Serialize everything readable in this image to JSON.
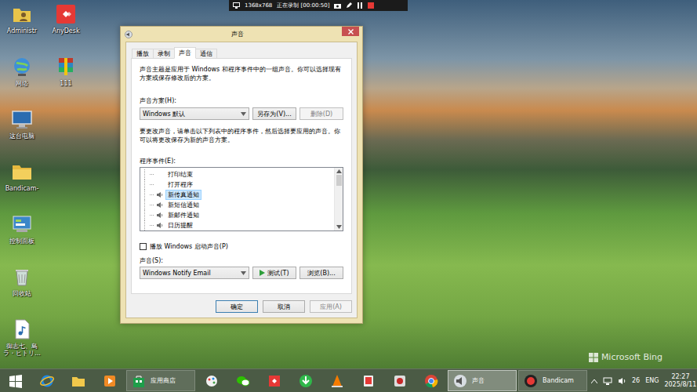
{
  "recorder_bar": {
    "resolution": "1368x768",
    "status": "正在录制 [00:00:50]"
  },
  "desktop": {
    "icons": [
      {
        "label": "Administr",
        "kind": "user"
      },
      {
        "label": "网络",
        "kind": "network"
      },
      {
        "label": "这台电脑",
        "kind": "computer"
      },
      {
        "label": "Bandicam-",
        "kind": "folder"
      },
      {
        "label": "控制面板",
        "kind": "control-panel"
      },
      {
        "label": "回收站",
        "kind": "recycle-bin"
      },
      {
        "label": "御志七、島ラ・ヒトリ...",
        "kind": "audio-file"
      },
      {
        "label": "AnyDesk",
        "kind": "anydesk"
      },
      {
        "label": "111",
        "kind": "archive"
      }
    ],
    "watermark": "Microsoft Bing"
  },
  "window": {
    "title": "声音"
  },
  "tabs": [
    {
      "label": "播放",
      "selected": false
    },
    {
      "label": "录制",
      "selected": false
    },
    {
      "label": "声音",
      "selected": true
    },
    {
      "label": "通信",
      "selected": false
    }
  ],
  "scheme": {
    "description": "声音主题是应用于 Windows 和程序事件中的一组声音。你可以选择现有方案或保存修改后的方案。",
    "label": "声音方案(H):",
    "value": "Windows 默认",
    "buttons": [
      {
        "label": "另存为(V)...",
        "disabled": false
      },
      {
        "label": "删除(D)",
        "disabled": true
      }
    ]
  },
  "events": {
    "description": "要更改声音，请单击以下列表中的程序事件，然后选择要应用的声音。你可以将更改保存为新的声音方案。",
    "label": "程序事件(E):",
    "items": [
      {
        "label": "打印结束",
        "sound": false,
        "selected": false
      },
      {
        "label": "打开程序",
        "sound": false,
        "selected": false
      },
      {
        "label": "新传真通知",
        "sound": true,
        "selected": true
      },
      {
        "label": "新短信通知",
        "sound": true,
        "selected": false
      },
      {
        "label": "新邮件通知",
        "sound": true,
        "selected": false
      },
      {
        "label": "日历提醒",
        "sound": true,
        "selected": false
      }
    ]
  },
  "startup_sound": {
    "label": "播放 Windows 启动声音(P)",
    "checked": false
  },
  "sound": {
    "label": "声音(S):",
    "value": "Windows Notify Email",
    "buttons": [
      {
        "label": "测试(T)",
        "kind": "test",
        "disabled": false
      },
      {
        "label": "浏览(B)...",
        "kind": "plain",
        "disabled": false
      }
    ]
  },
  "buttons": [
    {
      "label": "确定",
      "disabled": false,
      "default": true
    },
    {
      "label": "取消",
      "disabled": false,
      "default": false
    },
    {
      "label": "应用(A)",
      "disabled": true,
      "default": false
    }
  ],
  "taskbar": {
    "items": [
      {
        "kind": "start",
        "active": false
      },
      {
        "kind": "ie",
        "active": false
      },
      {
        "kind": "explorer",
        "active": false
      },
      {
        "kind": "media",
        "active": false
      },
      {
        "kind": "store",
        "label": "应用商店",
        "active": false
      },
      {
        "kind": "paint",
        "active": false
      },
      {
        "kind": "wechat",
        "active": false
      },
      {
        "kind": "anydesk",
        "active": false
      },
      {
        "kind": "download",
        "active": false
      },
      {
        "kind": "vlc",
        "active": false
      },
      {
        "kind": "tablet",
        "active": false
      },
      {
        "kind": "recorder",
        "active": false
      },
      {
        "kind": "browser",
        "active": false
      },
      {
        "kind": "sound",
        "label": "声音",
        "active": true
      },
      {
        "kind": "bandicam",
        "label": "Bandicam",
        "active": false
      }
    ],
    "tray": {
      "badge": "26",
      "language": "ENG",
      "time": "22:27",
      "date": "2025/8/11"
    }
  }
}
